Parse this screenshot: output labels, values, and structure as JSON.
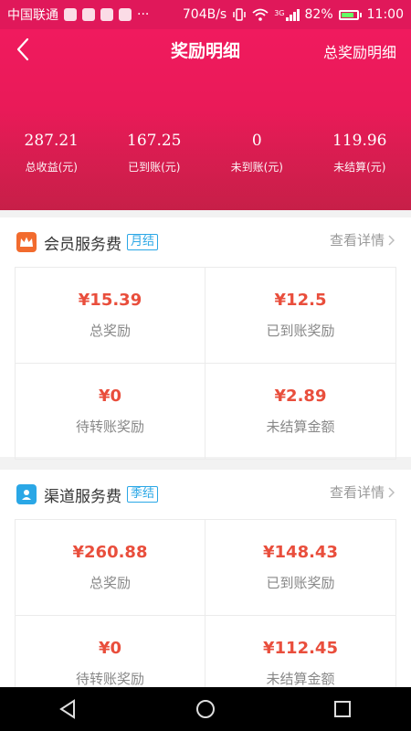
{
  "status_bar": {
    "carrier": "中国联通",
    "speed": "704B/s",
    "signal_type": "3G",
    "battery": "82%",
    "battery_level": 0.82,
    "time": "11:00"
  },
  "header": {
    "title": "奖励明细",
    "right_link": "总奖励明细",
    "stats": [
      {
        "value": "287.21",
        "label": "总收益(元)"
      },
      {
        "value": "167.25",
        "label": "已到账(元)"
      },
      {
        "value": "0",
        "label": "未到账(元)"
      },
      {
        "value": "119.96",
        "label": "未结算(元)"
      }
    ]
  },
  "sections": [
    {
      "title": "会员服务费",
      "tag": "月结",
      "link": "查看详情",
      "icon": "crown-icon",
      "icon_color": "#f26b2e",
      "cells": [
        {
          "value": "¥15.39",
          "label": "总奖励"
        },
        {
          "value": "¥12.5",
          "label": "已到账奖励"
        },
        {
          "value": "¥0",
          "label": "待转账奖励"
        },
        {
          "value": "¥2.89",
          "label": "未结算金额"
        }
      ]
    },
    {
      "title": "渠道服务费",
      "tag": "季结",
      "link": "查看详情",
      "icon": "location-person-icon",
      "icon_color": "#2aa7e6",
      "cells": [
        {
          "value": "¥260.88",
          "label": "总奖励"
        },
        {
          "value": "¥148.43",
          "label": "已到账奖励"
        },
        {
          "value": "¥0",
          "label": "待转账奖励"
        },
        {
          "value": "¥112.45",
          "label": "未结算金额"
        }
      ]
    }
  ],
  "colors": {
    "header": "#e91a58",
    "accent_value": "#e94e3c",
    "tag": "#2aa7e6"
  }
}
